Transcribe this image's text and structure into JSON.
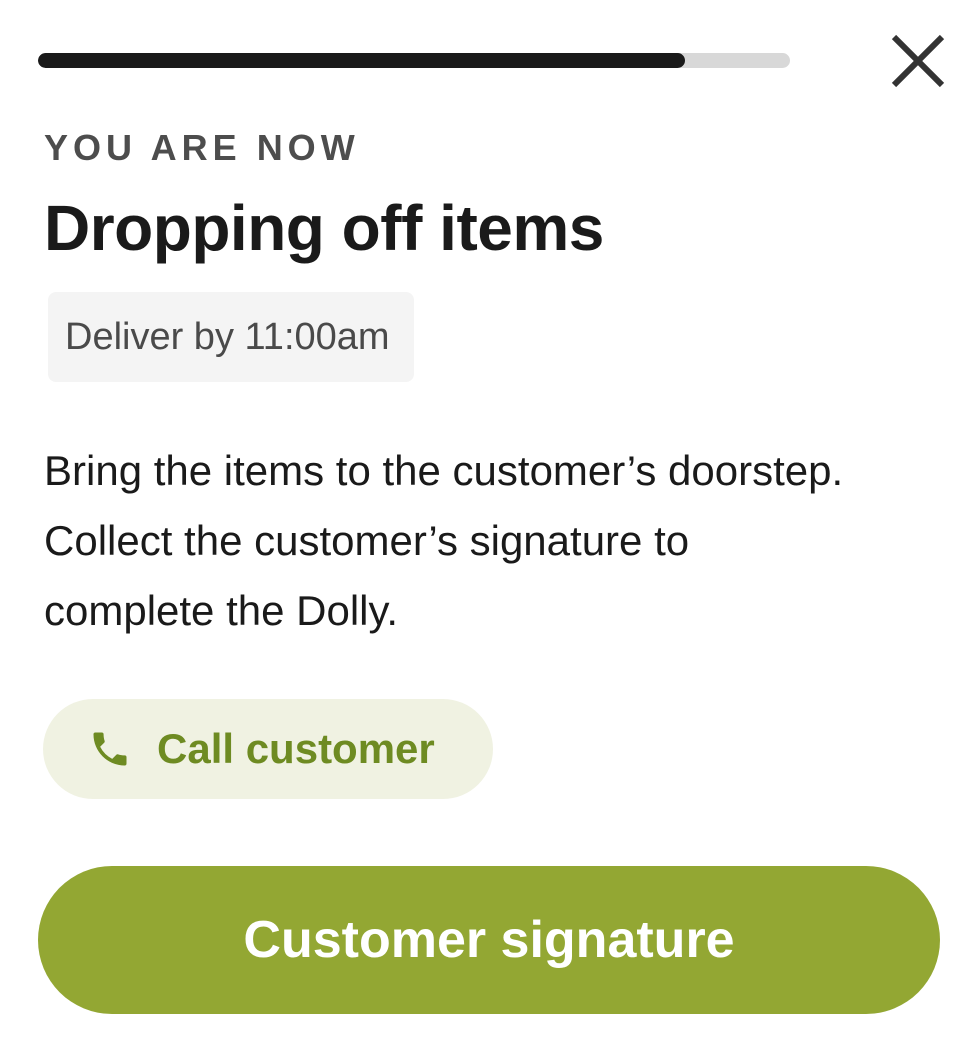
{
  "progress": {
    "value": 0.86
  },
  "header": {
    "close_icon": "close-icon"
  },
  "status": {
    "eyebrow": "YOU ARE NOW",
    "title": "Dropping off items",
    "deadline": "Deliver by 11:00am"
  },
  "instructions": {
    "text": "Bring the items to the customer’s doorstep. Collect the customer’s signature to complete the Dolly."
  },
  "actions": {
    "call_label": "Call customer",
    "call_icon": "phone-icon",
    "primary_label": "Customer signature"
  },
  "colors": {
    "accent": "#93a733",
    "accent_text": "#6e8b22",
    "accent_soft": "#f0f2e2",
    "progress_fill": "#1a1a1a",
    "progress_track": "#d8d8d8"
  }
}
